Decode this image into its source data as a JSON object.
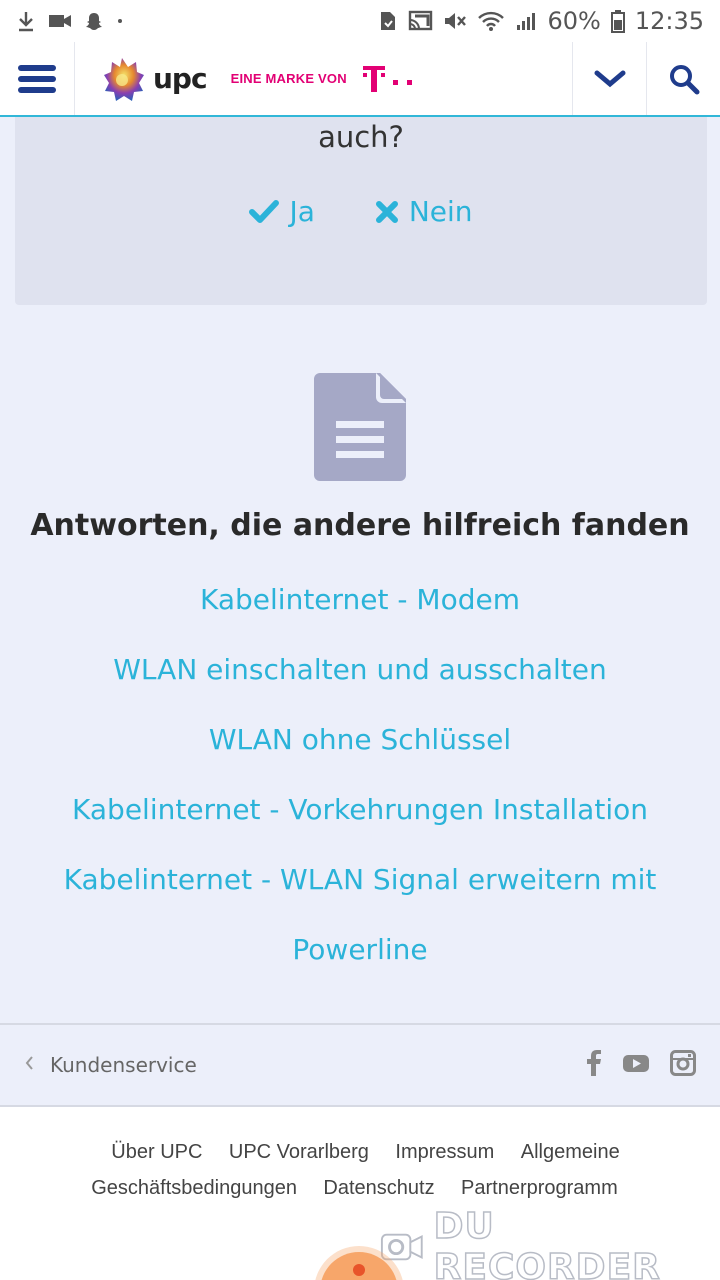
{
  "status_bar": {
    "battery": "60%",
    "time": "12:35"
  },
  "header": {
    "brand": "upc",
    "tagline": "EINE MARKE VON"
  },
  "feedback": {
    "question": "auch?",
    "yes_label": "Ja",
    "no_label": "Nein"
  },
  "answers": {
    "title": "Antworten, die andere hilfreich fanden",
    "links": [
      "Kabelinternet - Modem",
      "WLAN einschalten und ausschalten",
      "WLAN ohne Schlüssel",
      "Kabelinternet - Vorkehrungen Installation",
      "Kabelinternet - WLAN Signal erweitern mit Powerline"
    ]
  },
  "breadcrumb": {
    "label": "Kundenservice"
  },
  "footer": {
    "links": [
      "Über UPC",
      "UPC Vorarlberg",
      "Impressum",
      "Allgemeine Geschäftsbedingungen",
      "Datenschutz",
      "Partnerprogramm"
    ]
  },
  "watermark": {
    "text": "DU RECORDER"
  },
  "colors": {
    "accent": "#2bb3d9",
    "telekom": "#e20074",
    "navy": "#1f3c8c"
  }
}
